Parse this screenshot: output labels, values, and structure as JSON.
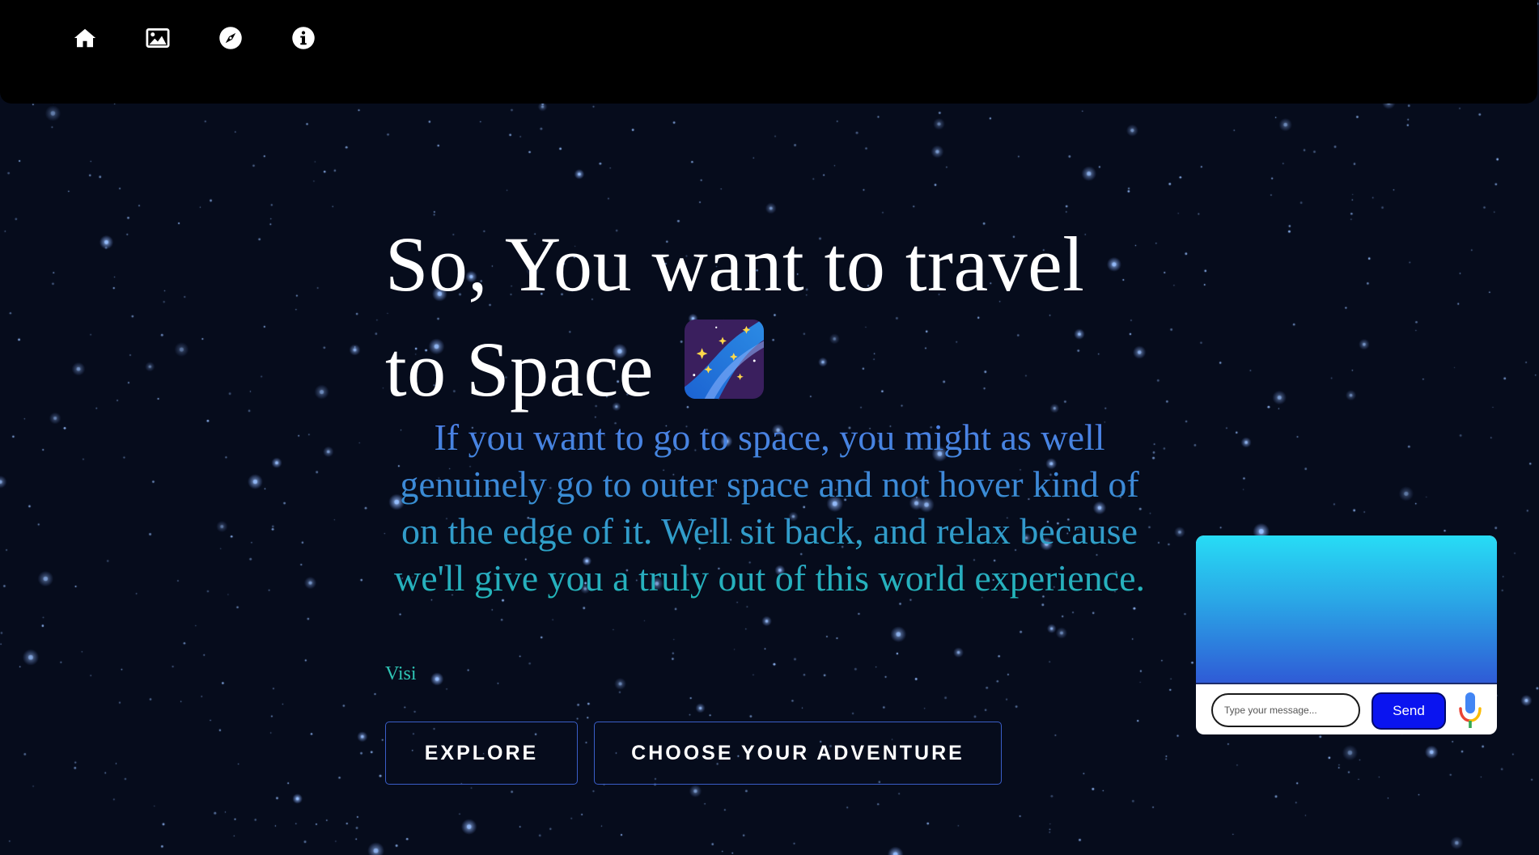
{
  "nav": {
    "items": [
      {
        "icon": "home-icon"
      },
      {
        "icon": "image-icon"
      },
      {
        "icon": "compass-icon"
      },
      {
        "icon": "info-icon"
      }
    ]
  },
  "hero": {
    "headline_line1": "So, You want to travel",
    "headline_line2": "to Space",
    "headline_emoji": "milky-way-icon",
    "subtext": "If you want to go to space, you might as well genuinely go to outer space and not hover kind of on the edge of it. Well sit back, and relax because we'll give you a truly out of this world experience.",
    "visi_text": "Visi"
  },
  "buttons": {
    "explore_label": "EXPLORE",
    "adventure_label": "CHOOSE YOUR ADVENTURE"
  },
  "chat": {
    "input_value": "",
    "input_placeholder": "Type your message...",
    "send_label": "Send",
    "mic_icon": "microphone-icon"
  },
  "colors": {
    "background": "#060c1c",
    "topbar": "#000000",
    "subtext_gradient_start": "#4f7fe8",
    "subtext_gradient_end": "#22b8b8",
    "visi": "#2fc4b4",
    "button_border": "#3a5ec8",
    "send_button": "#0a14f0",
    "chat_gradient_start": "#27dcf5",
    "chat_gradient_end": "#2f5bd6"
  }
}
